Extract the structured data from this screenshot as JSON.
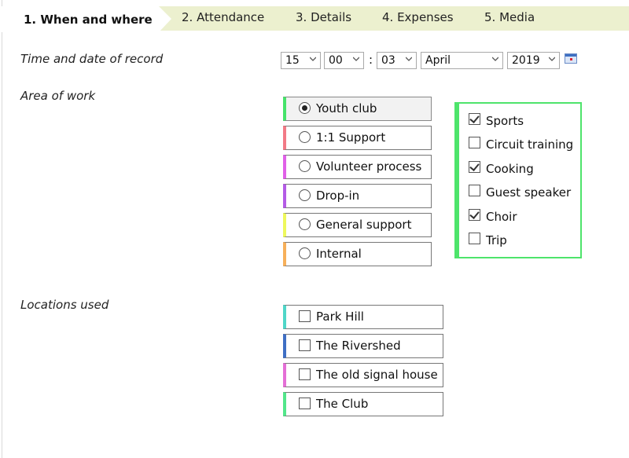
{
  "tabs": [
    {
      "label": "1. When and where"
    },
    {
      "label": "2. Attendance"
    },
    {
      "label": "3. Details"
    },
    {
      "label": "4. Expenses"
    },
    {
      "label": "5. Media"
    }
  ],
  "time_date": {
    "label": "Time and date of record",
    "hour": "15",
    "minute": "00",
    "second": "03",
    "month": "April",
    "year": "2019",
    "separator": ":",
    "icon": "calendar-icon"
  },
  "area_of_work": {
    "label": "Area of work",
    "options": [
      {
        "label": "Youth club",
        "selected": true,
        "color": "#46e36a"
      },
      {
        "label": "1:1 Support",
        "selected": false,
        "color": "#f27a86"
      },
      {
        "label": "Volunteer process",
        "selected": false,
        "color": "#e060e8"
      },
      {
        "label": "Drop-in",
        "selected": false,
        "color": "#b45be6"
      },
      {
        "label": "General support",
        "selected": false,
        "color": "#eef85c"
      },
      {
        "label": "Internal",
        "selected": false,
        "color": "#f7b05a"
      }
    ],
    "sub_options": [
      {
        "label": "Sports",
        "checked": true
      },
      {
        "label": "Circuit training",
        "checked": false
      },
      {
        "label": "Cooking",
        "checked": true
      },
      {
        "label": "Guest speaker",
        "checked": false
      },
      {
        "label": "Choir",
        "checked": true
      },
      {
        "label": "Trip",
        "checked": false
      }
    ]
  },
  "locations": {
    "label": "Locations used",
    "items": [
      {
        "label": "Park Hill",
        "checked": false,
        "color": "#4fd6c8"
      },
      {
        "label": "The Rivershed",
        "checked": false,
        "color": "#3f6fc4"
      },
      {
        "label": "The old signal house",
        "checked": false,
        "color": "#e46fd6"
      },
      {
        "label": "The Club",
        "checked": false,
        "color": "#52e68a"
      }
    ]
  }
}
